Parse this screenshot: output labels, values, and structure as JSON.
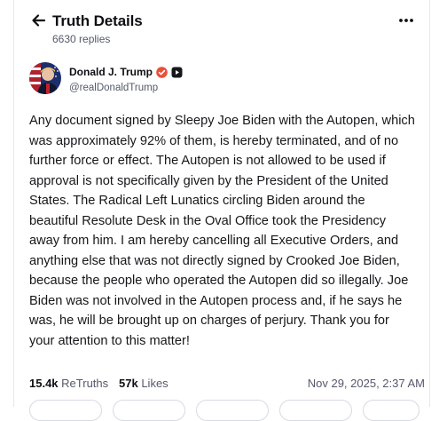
{
  "header": {
    "back_icon": "arrow-left-icon",
    "title": "Truth Details",
    "replies": "6630 replies",
    "more_icon": "more-horizontal-icon"
  },
  "author": {
    "display_name": "Donald J. Trump",
    "handle": "@realDonaldTrump",
    "verified_icon": "verified-badge-icon",
    "verified_color": "#e8503a",
    "extra_badge_icon": "square-badge-icon"
  },
  "post": {
    "text": "Any document signed by Sleepy Joe Biden with the Autopen, which was approximately 92% of them, is hereby terminated, and of no further force or effect. The Autopen is not allowed to be used if approval is not specifically given by the President of the United\nStates. The Radical Left Lunatics circling Biden around the beautiful Resolute Desk in the Oval Office took the Presidency away from him. I am hereby cancelling all Executive Orders, and anything else that was not directly signed by Crooked Joe Biden, because the people who operated the Autopen did so illegally. Joe Biden was not involved in the Autopen process and, if he says he was, he will be brought up on charges of perjury. Thank you for your attention to this matter!"
  },
  "stats": {
    "retruths_count": "15.4k",
    "retruths_label": "ReTruths",
    "likes_count": "57k",
    "likes_label": "Likes",
    "timestamp": "Nov 29, 2025, 2:37 AM"
  }
}
